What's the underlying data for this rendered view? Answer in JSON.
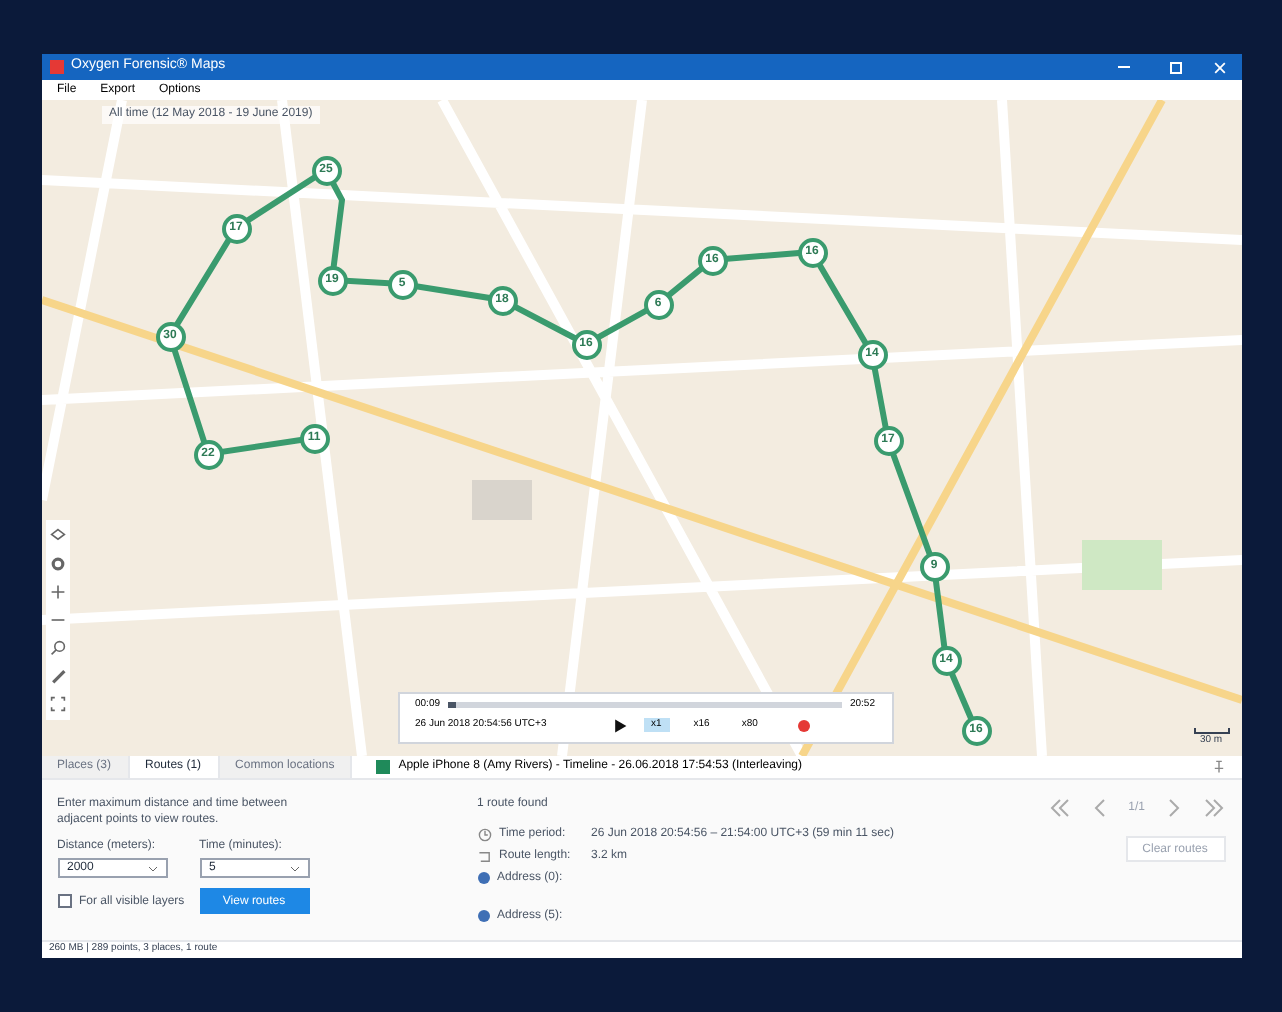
{
  "window": {
    "title": "Oxygen Forensic® Maps"
  },
  "menu": [
    "File",
    "Export",
    "Options"
  ],
  "map": {
    "time_range": "All time (12 May 2018 - 19 June 2019)",
    "scale": "30 m",
    "markers": [
      "25",
      "17",
      "19",
      "5",
      "18",
      "16",
      "6",
      "16",
      "16",
      "14",
      "17",
      "9",
      "14",
      "16",
      "30",
      "22",
      "11"
    ]
  },
  "player": {
    "start": "00:09",
    "end": "20:52",
    "level": 0.02,
    "timestamp": "26 Jun 2018 20:54:56 UTC+3",
    "speeds": [
      {
        "label": "x1",
        "selected": true
      },
      {
        "label": "x16",
        "selected": false
      },
      {
        "label": "x80",
        "selected": false
      }
    ]
  },
  "tabs": [
    {
      "label": "Places (3)",
      "selected": false
    },
    {
      "label": "Routes (1)",
      "selected": true
    },
    {
      "label": "Common locations",
      "selected": false
    }
  ],
  "layer": {
    "title": "Apple iPhone 8 (Amy Rivers) - Timeline - 26.06.2018 17:54:53 (Interleaving)",
    "color": "#1f8a5a"
  },
  "routes_form": {
    "hint": "Enter maximum distance and time between adjacent points to view routes.",
    "distance_label": "Distance (meters):",
    "distance": "2000",
    "time_label": "Time (minutes):",
    "time": "5",
    "all_layers": {
      "label": "For all visible layers",
      "checked": false
    },
    "button": "View routes"
  },
  "result": {
    "summary": "1 route found",
    "time_label": "Time period:",
    "time_value": "26 Jun 2018 20:54:56 – 21:54:00 UTC+3 (59 min 11 sec)",
    "length_label": "Route length:",
    "length_value": "3.2 km",
    "addresses": [
      "Address (0):",
      "Address (5):"
    ],
    "pager": "1/1",
    "clear": "Clear routes"
  },
  "status_bar": "260 MB | 289 points, 3 places, 1 route"
}
